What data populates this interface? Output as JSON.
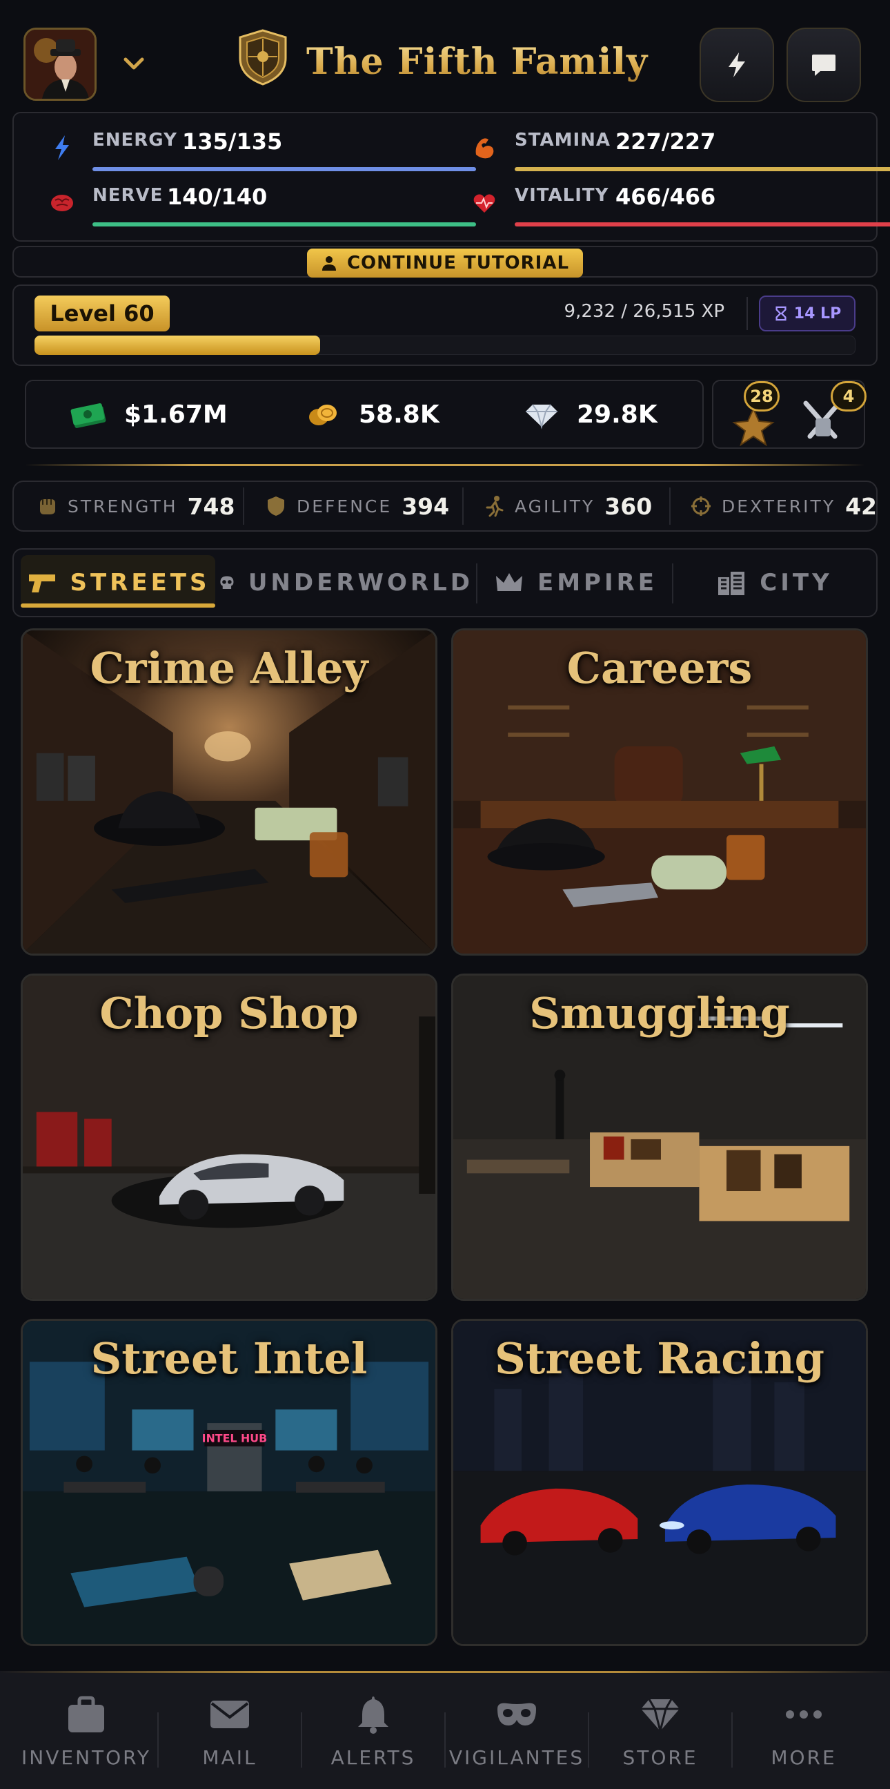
{
  "header": {
    "title": "The Fifth Family",
    "avatar_icon": "mobster-avatar-icon",
    "crest_icon": "family-crest-icon",
    "buttons": [
      {
        "icon": "lightning-icon"
      },
      {
        "icon": "chat-icon"
      }
    ]
  },
  "stats": [
    {
      "label": "ENERGY",
      "value": "135/135",
      "icon": "energy-bolt-icon",
      "color": "#6f8fe6",
      "fraction": 1.0
    },
    {
      "label": "STAMINA",
      "value": "227/227",
      "icon": "flexed-arm-icon",
      "color": "#d5b24f",
      "fraction": 1.0
    },
    {
      "label": "NERVE",
      "value": "140/140",
      "icon": "brain-icon",
      "color": "#3dbf86",
      "fraction": 1.0
    },
    {
      "label": "VITALITY",
      "value": "466/466",
      "icon": "heart-icon",
      "color": "#e0404a",
      "fraction": 1.0
    }
  ],
  "tutorial": {
    "label": "CONTINUE TUTORIAL",
    "icon": "person-icon"
  },
  "level": {
    "label": "Level 60",
    "xp_text": "9,232 / 26,515 XP",
    "xp_fraction": 0.348,
    "lp_text": "14 LP",
    "lp_icon": "hourglass-icon"
  },
  "currency": [
    {
      "value": "$1.67M",
      "icon": "cash-icon"
    },
    {
      "value": "58.8K",
      "icon": "coins-icon"
    },
    {
      "value": "29.8K",
      "icon": "diamond-icon"
    }
  ],
  "badges": [
    {
      "count": "28",
      "icon": "star-medal-icon"
    },
    {
      "count": "4",
      "icon": "crossed-weapons-icon"
    }
  ],
  "attributes": [
    {
      "label": "STRENGTH",
      "value": "748",
      "icon": "fist-icon"
    },
    {
      "label": "DEFENCE",
      "value": "394",
      "icon": "shield-icon"
    },
    {
      "label": "AGILITY",
      "value": "360",
      "icon": "runner-icon"
    },
    {
      "label": "DEXTERITY",
      "value": "42",
      "icon": "crosshair-icon"
    }
  ],
  "tabs": [
    {
      "label": "STREETS",
      "icon": "pistol-icon",
      "active": true
    },
    {
      "label": "UNDERWORLD",
      "icon": "skull-icon",
      "active": false
    },
    {
      "label": "EMPIRE",
      "icon": "crown-icon",
      "active": false
    },
    {
      "label": "CITY",
      "icon": "buildings-icon",
      "active": false
    }
  ],
  "cards": [
    {
      "title": "Crime Alley"
    },
    {
      "title": "Careers"
    },
    {
      "title": "Chop Shop"
    },
    {
      "title": "Smuggling"
    },
    {
      "title": "Street Intel",
      "sign": "INTEL HUB"
    },
    {
      "title": "Street Racing"
    }
  ],
  "nav": [
    {
      "label": "INVENTORY",
      "icon": "briefcase-icon"
    },
    {
      "label": "MAIL",
      "icon": "envelope-icon"
    },
    {
      "label": "ALERTS",
      "icon": "bell-icon"
    },
    {
      "label": "VIGILANTES",
      "icon": "mask-icon"
    },
    {
      "label": "STORE",
      "icon": "gem-icon"
    },
    {
      "label": "MORE",
      "icon": "dots-icon"
    }
  ]
}
